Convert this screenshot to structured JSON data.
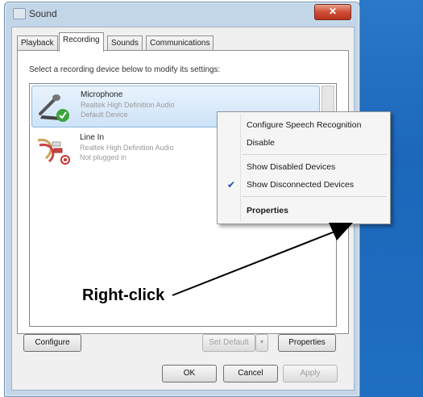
{
  "window": {
    "title": "Sound",
    "close_glyph": "✕"
  },
  "tabs": [
    {
      "label": "Playback"
    },
    {
      "label": "Recording",
      "active": true
    },
    {
      "label": "Sounds"
    },
    {
      "label": "Communications"
    }
  ],
  "panel": {
    "instruction": "Select a recording device below to modify its settings:",
    "devices": [
      {
        "name": "Microphone",
        "detail": "Realtek High Definition Audio",
        "status": "Default Device",
        "icon": "microphone-icon",
        "badge": "green-check-icon",
        "selected": true
      },
      {
        "name": "Line In",
        "detail": "Realtek High Definition Audio",
        "status": "Not plugged in",
        "icon": "line-in-cable-icon",
        "badge": "red-unplugged-icon",
        "selected": false
      }
    ]
  },
  "buttons": {
    "configure": "Configure",
    "set_default": "Set Default",
    "dropdown_glyph": "▼",
    "properties": "Properties",
    "ok": "OK",
    "cancel": "Cancel",
    "apply": "Apply"
  },
  "context_menu": {
    "items": [
      {
        "label": "Configure Speech Recognition"
      },
      {
        "label": "Disable"
      },
      {
        "label": "Show Disabled Devices"
      },
      {
        "label": "Show Disconnected Devices",
        "checked": true
      },
      {
        "label": "Properties",
        "bold": true
      }
    ],
    "check_glyph": "✔"
  },
  "annotation": {
    "text": "Right-click"
  },
  "colors": {
    "desktop": "#1f6fc3",
    "window_frame": "#c3d6e8",
    "selection": "#cde3f8",
    "close_button": "#cf4d35",
    "check_badge": "#3aa53a"
  }
}
